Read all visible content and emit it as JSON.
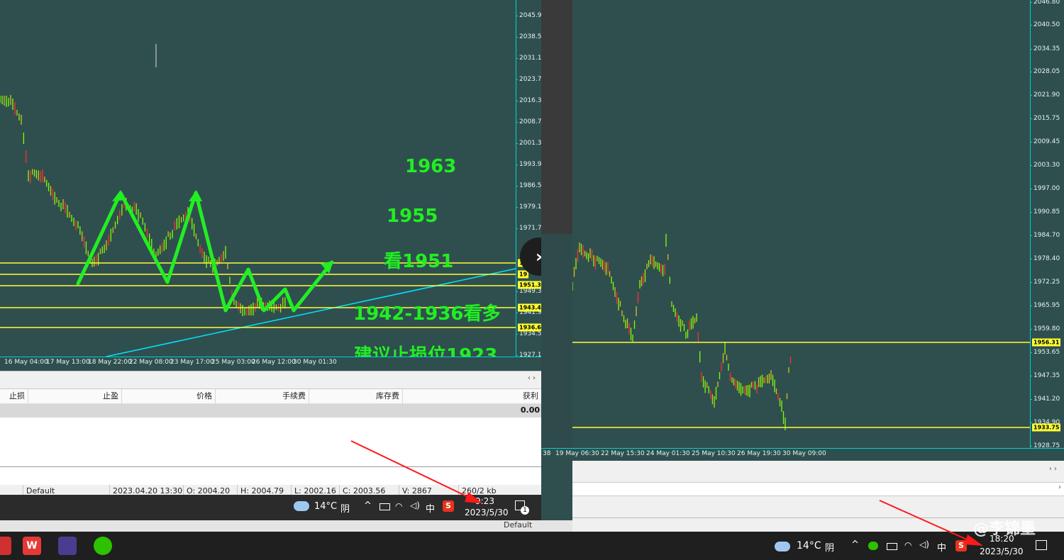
{
  "left_chart": {
    "y_ticks": [
      "2045.90",
      "2038.50",
      "2031.10",
      "2023.70",
      "2016.30",
      "2008.70",
      "2001.30",
      "1993.90",
      "1986.50",
      "1979.10",
      "1971.70",
      "1949.30",
      "1941.90",
      "1934.50",
      "1927.10"
    ],
    "x_ticks": [
      "16 May 04:00",
      "17 May 13:00",
      "18 May 22:00",
      "22 May 08:00",
      "23 May 17:00",
      "25 May 03:00",
      "26 May 12:00",
      "30 May 01:30"
    ],
    "level_tags": [
      "1951.36",
      "1943.46",
      "1936.62"
    ],
    "partial_tags": [
      "19",
      "19"
    ],
    "annotations": [
      "1963",
      "1955",
      "看1951",
      "1942-1936看多",
      "建议止损位1923"
    ]
  },
  "right_chart": {
    "y_ticks": [
      "2046.80",
      "2040.50",
      "2034.35",
      "2028.05",
      "2021.90",
      "2015.75",
      "2009.45",
      "2003.30",
      "1997.00",
      "1990.85",
      "1984.70",
      "1978.40",
      "1972.25",
      "1965.95",
      "1959.80",
      "1953.65",
      "1947.35",
      "1941.20",
      "1934.90",
      "1928.75"
    ],
    "x_ticks": [
      "19 May 06:30",
      "22 May 15:30",
      "24 May 01:30",
      "25 May 10:30",
      "26 May 19:30",
      "30 May 09:00"
    ],
    "partial_x": "38",
    "level_tags": [
      "1956.31",
      "1933.75"
    ]
  },
  "terminal": {
    "columns": [
      "止损",
      "止盈",
      "价格",
      "手续费",
      "库存费",
      "获利"
    ],
    "profit_value": "0.00",
    "status": [
      "Default",
      "2023.04.20 13:30",
      "O: 2004.20",
      "H: 2004.79",
      "L: 2002.16",
      "C: 2003.56",
      "V: 2867",
      "260/2 kb"
    ],
    "right_status": "Default"
  },
  "left_tray": {
    "temp": "14°C",
    "weather": "阴",
    "ime": "中",
    "time": "9:23",
    "date": "2023/5/30",
    "notif_count": "1"
  },
  "right_tray": {
    "temp": "14°C",
    "weather": "阴",
    "ime": "中",
    "time": "18:20",
    "date": "2023/5/30",
    "watermark": "@李锦墨"
  },
  "colors": {
    "chart_bg": "#2f4f4f",
    "level_line": "#ffff33",
    "trend_line": "#00e5ff",
    "arrow": "#22ee22",
    "candle_up": "#7fff00",
    "candle_down": "#ff3030",
    "candle_neutral": "#d4c020"
  }
}
